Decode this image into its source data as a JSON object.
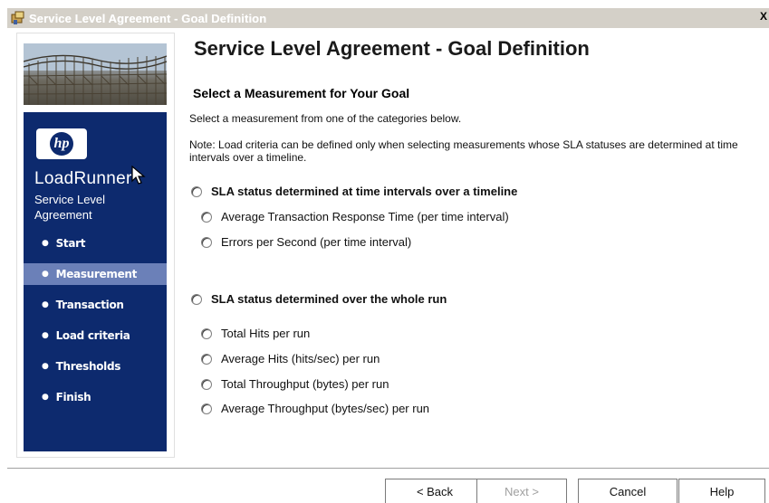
{
  "window": {
    "title": "Service Level Agreement - Goal Definition",
    "close_label": "X"
  },
  "sidebar": {
    "logo_text": "hp",
    "product_name": "LoadRunner",
    "product_sub": "Service Level Agreement",
    "items": [
      {
        "label": "Start"
      },
      {
        "label": "Measurement",
        "active": true
      },
      {
        "label": "Transaction"
      },
      {
        "label": "Load criteria"
      },
      {
        "label": "Thresholds"
      },
      {
        "label": "Finish"
      }
    ]
  },
  "main": {
    "page_title": "Service Level Agreement - Goal Definition",
    "section_title": "Select a Measurement for Your Goal",
    "description": "Select a measurement from one of the categories below.",
    "note": "Note: Load criteria can be defined only when selecting measurements whose SLA statuses are determined at time intervals over a timeline.",
    "group1": {
      "label": "SLA status determined at time intervals over a timeline",
      "options": [
        {
          "label": "Average Transaction Response Time (per time interval)"
        },
        {
          "label": "Errors per Second (per time interval)"
        }
      ]
    },
    "group2": {
      "label": "SLA status determined over the whole run",
      "options": [
        {
          "label": "Total Hits per run"
        },
        {
          "label": "Average Hits (hits/sec) per run"
        },
        {
          "label": "Total Throughput (bytes) per run"
        },
        {
          "label": "Average Throughput (bytes/sec) per run"
        }
      ]
    }
  },
  "buttons": {
    "back": "< Back",
    "next": "Next >",
    "cancel": "Cancel",
    "help": "Help"
  },
  "colors": {
    "sidebar_bg": "#0d2a6e",
    "sidebar_active": "#6b80b8"
  }
}
